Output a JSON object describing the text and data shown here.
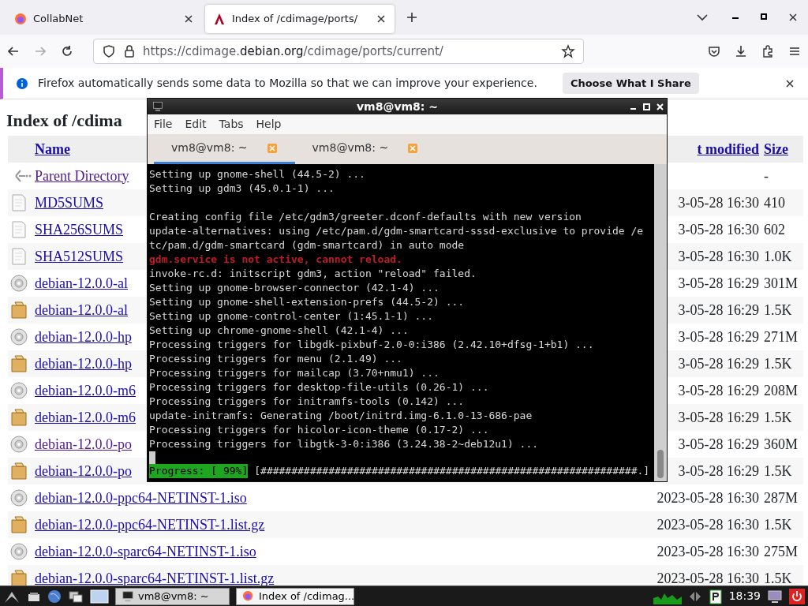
{
  "browser": {
    "tabs": [
      {
        "title": "CollabNet",
        "selected": false
      },
      {
        "title": "Index of /cdimage/ports/",
        "selected": true
      }
    ],
    "url": {
      "prefix": "https://cdimage.",
      "domain": "debian.org",
      "path": "/cdimage/ports/current/"
    },
    "notification": {
      "message": "Firefox automatically sends some data to Mozilla so that we can improve your experience.",
      "button": "Choose What I Share"
    },
    "page": {
      "heading": "Index of /cdima",
      "columns": [
        "Name",
        "t modified",
        "Size"
      ],
      "rows": [
        {
          "kind": "back",
          "name": "Parent Directory",
          "visited": true,
          "size": "-"
        },
        {
          "kind": "text",
          "name": "MD5SUMS",
          "visited": false,
          "modified": "3-05-28 16:30",
          "size": "410"
        },
        {
          "kind": "text",
          "name": "SHA256SUMS",
          "visited": false,
          "modified": "3-05-28 16:30",
          "size": "602"
        },
        {
          "kind": "text",
          "name": "SHA512SUMS",
          "visited": false,
          "modified": "3-05-28 16:30",
          "size": "1.0K"
        },
        {
          "kind": "disc",
          "name": "debian-12.0.0-al",
          "visited": false,
          "modified": "3-05-28 16:29",
          "size": "301M"
        },
        {
          "kind": "package",
          "name": "debian-12.0.0-al",
          "visited": false,
          "modified": "3-05-28 16:29",
          "size": "1.5K"
        },
        {
          "kind": "disc",
          "name": "debian-12.0.0-hp",
          "visited": false,
          "modified": "3-05-28 16:29",
          "size": "271M"
        },
        {
          "kind": "package",
          "name": "debian-12.0.0-hp",
          "visited": false,
          "modified": "3-05-28 16:29",
          "size": "1.5K"
        },
        {
          "kind": "disc",
          "name": "debian-12.0.0-m6",
          "visited": false,
          "modified": "3-05-28 16:29",
          "size": "208M"
        },
        {
          "kind": "package",
          "name": "debian-12.0.0-m6",
          "visited": false,
          "modified": "3-05-28 16:29",
          "size": "1.5K"
        },
        {
          "kind": "disc",
          "name": "debian-12.0.0-po",
          "visited": true,
          "modified": "3-05-28 16:29",
          "size": "360M"
        },
        {
          "kind": "package",
          "name": "debian-12.0.0-po",
          "visited": false,
          "modified": "3-05-28 16:29",
          "size": "1.5K"
        },
        {
          "kind": "disc",
          "name": "debian-12.0.0-ppc64-NETINST-1.iso",
          "visited": false,
          "modified": "2023-05-28 16:30",
          "size": "287M"
        },
        {
          "kind": "package",
          "name": "debian-12.0.0-ppc64-NETINST-1.list.gz",
          "visited": false,
          "modified": "2023-05-28 16:30",
          "size": "1.5K"
        },
        {
          "kind": "disc",
          "name": "debian-12.0.0-sparc64-NETINST-1.iso",
          "visited": false,
          "modified": "2023-05-28 16:30",
          "size": "275M"
        },
        {
          "kind": "package",
          "name": "debian-12.0.0-sparc64-NETINST-1.list.gz",
          "visited": false,
          "modified": "2023-05-28 16:30",
          "size": "1.5K"
        }
      ]
    }
  },
  "terminal": {
    "title": "vm8@vm8: ~",
    "menu": [
      "File",
      "Edit",
      "Tabs",
      "Help"
    ],
    "tabs": [
      {
        "title": "vm8@vm8: ~",
        "selected": true
      },
      {
        "title": "vm8@vm8: ~",
        "selected": false
      }
    ],
    "lines": [
      {
        "kind": "output",
        "text": "Setting up gnome-shell (44.5-2) ..."
      },
      {
        "kind": "output",
        "text": "Setting up gdm3 (45.0.1-1) ..."
      },
      {
        "kind": "output_after_blank",
        "text": "Creating config file /etc/gdm3/greeter.dconf-defaults with new version"
      },
      {
        "kind": "output",
        "text": "update-alternatives: using /etc/pam.d/gdm-smartcard-sssd-exclusive to provide /e"
      },
      {
        "kind": "output",
        "text": "tc/pam.d/gdm-smartcard (gdm-smartcard) in auto mode"
      },
      {
        "kind": "error",
        "text": "gdm.service is not active, cannot reload."
      },
      {
        "kind": "output",
        "text": "invoke-rc.d: initscript gdm3, action \"reload\" failed."
      },
      {
        "kind": "output",
        "text": "Setting up gnome-browser-connector (42.1-4) ..."
      },
      {
        "kind": "output",
        "text": "Setting up gnome-shell-extension-prefs (44.5-2) ..."
      },
      {
        "kind": "output",
        "text": "Setting up gnome-control-center (1:45.1-1) ..."
      },
      {
        "kind": "output",
        "text": "Setting up chrome-gnome-shell (42.1-4) ..."
      },
      {
        "kind": "output",
        "text": "Processing triggers for libgdk-pixbuf-2.0-0:i386 (2.42.10+dfsg-1+b1) ..."
      },
      {
        "kind": "output",
        "text": "Processing triggers for menu (2.1.49) ..."
      },
      {
        "kind": "output",
        "text": "Processing triggers for mailcap (3.70+nmu1) ..."
      },
      {
        "kind": "output",
        "text": "Processing triggers for desktop-file-utils (0.26-1) ..."
      },
      {
        "kind": "output",
        "text": "Processing triggers for initramfs-tools (0.142) ..."
      },
      {
        "kind": "output",
        "text": "update-initramfs: Generating /boot/initrd.img-6.1.0-13-686-pae"
      },
      {
        "kind": "output",
        "text": "Processing triggers for hicolor-icon-theme (0.17-2) ..."
      },
      {
        "kind": "output",
        "text": "Processing triggers for libgtk-3-0:i386 (3.24.38-2~deb12u1) ..."
      }
    ],
    "progress": {
      "label": "Progress: [ 99%]",
      "bar": "[#############################################################.]"
    }
  },
  "taskbar": {
    "tasks": [
      {
        "kind": "terminal",
        "title": "vm8@vm8: ~",
        "selected": false
      },
      {
        "kind": "browser",
        "title": "Index of /cdimag...",
        "selected": true
      }
    ],
    "clock": "18:39"
  }
}
